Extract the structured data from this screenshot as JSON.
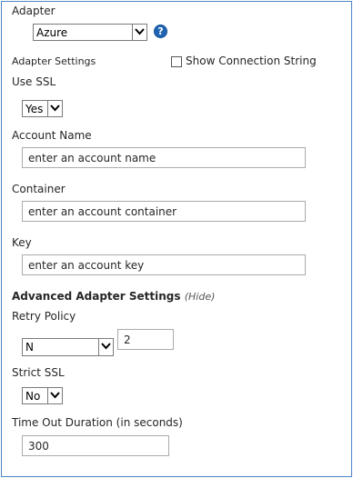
{
  "adapter": {
    "label": "Adapter",
    "selected": "Azure",
    "help_glyph": "?"
  },
  "adapter_settings": {
    "label": "Adapter Settings",
    "show_connection_string_label": "Show Connection String",
    "show_connection_string_checked": false
  },
  "use_ssl": {
    "label": "Use SSL",
    "selected": "Yes"
  },
  "account_name": {
    "label": "Account Name",
    "value": "enter an account name"
  },
  "container": {
    "label": "Container",
    "value": "enter an account container"
  },
  "key": {
    "label": "Key",
    "value": "enter an account key"
  },
  "advanced": {
    "title": "Advanced Adapter Settings",
    "toggle": "(Hide)"
  },
  "retry_policy": {
    "label": "Retry Policy",
    "selected": "N",
    "count": "2"
  },
  "strict_ssl": {
    "label": "Strict SSL",
    "selected": "No"
  },
  "timeout": {
    "label": "Time Out Duration (in seconds)",
    "value": "300"
  },
  "icons": {
    "dropdown": "chevron-down-icon",
    "help": "help-icon"
  },
  "colors": {
    "frame_border": "#4d84c4",
    "help_icon": "#1f65b4"
  }
}
